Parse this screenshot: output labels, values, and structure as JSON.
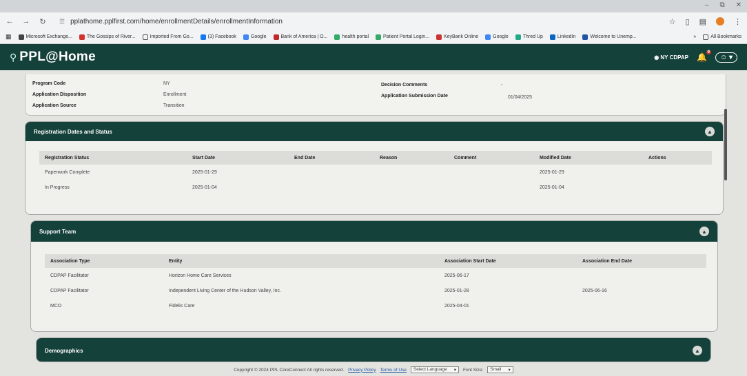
{
  "browser": {
    "url": "pplathome.pplfirst.com/home/enrollmentDetails/enrollmentInformation",
    "bookmarks": [
      "Microsoft Exchange...",
      "The Gossips of River...",
      "Imported From Go...",
      "(3) Facebook",
      "Google",
      "Bank of America | O...",
      "health portal",
      "Patient Portal Login...",
      "KeyBank Online",
      "Google",
      "Thred Up",
      "LinkedIn",
      "Welcome to Unemp..."
    ],
    "all_bookmarks": "All Bookmarks"
  },
  "header": {
    "logo": "PPL@Home",
    "program": "NY CDPAP",
    "notification_count": "9"
  },
  "info": {
    "program_code_label": "Program Code",
    "program_code": "NY",
    "disposition_label": "Application Disposition",
    "disposition": "Enrollment",
    "source_label": "Application Source",
    "source": "Transition",
    "decision_label": "Decision Comments",
    "decision": "-",
    "submission_label": "Application Submission Date",
    "submission": "01/04/2025"
  },
  "registration": {
    "title": "Registration Dates and Status",
    "columns": [
      "Registration Status",
      "Start Date",
      "End Date",
      "Reason",
      "Comment",
      "Modified Date",
      "Actions"
    ],
    "rows": [
      [
        "Paperwork Complete",
        "2025-01-29",
        "",
        "",
        "",
        "2025-01-29",
        ""
      ],
      [
        "In Progress",
        "2025-01-04",
        "",
        "",
        "",
        "2025-01-04",
        ""
      ]
    ]
  },
  "support": {
    "title": "Support Team",
    "columns": [
      "Association Type",
      "Entity",
      "Association Start Date",
      "Association End Date"
    ],
    "rows": [
      [
        "CDPAP Facilitator",
        "Horizon Home Care Services",
        "2025-06-17",
        ""
      ],
      [
        "CDPAP Facilitator",
        "Independent Living Center of the Hudson Valley, Inc.",
        "2025-01-28",
        "2025-06-16"
      ],
      [
        "MCO",
        "Fidelis Care",
        "2025-04-01",
        ""
      ]
    ]
  },
  "demographics": {
    "title": "Demographics"
  },
  "footer": {
    "copyright": "Copyright © 2024 PPL CoreConnect All rights reserved.",
    "privacy": "Privacy Policy",
    "terms": "Terms of Use",
    "language": "Select Language",
    "font_size_label": "Font Size:",
    "font_size": "Small"
  },
  "colors": {
    "brand": "#15413b",
    "link": "#2455a4",
    "bell": "#f4c542"
  }
}
